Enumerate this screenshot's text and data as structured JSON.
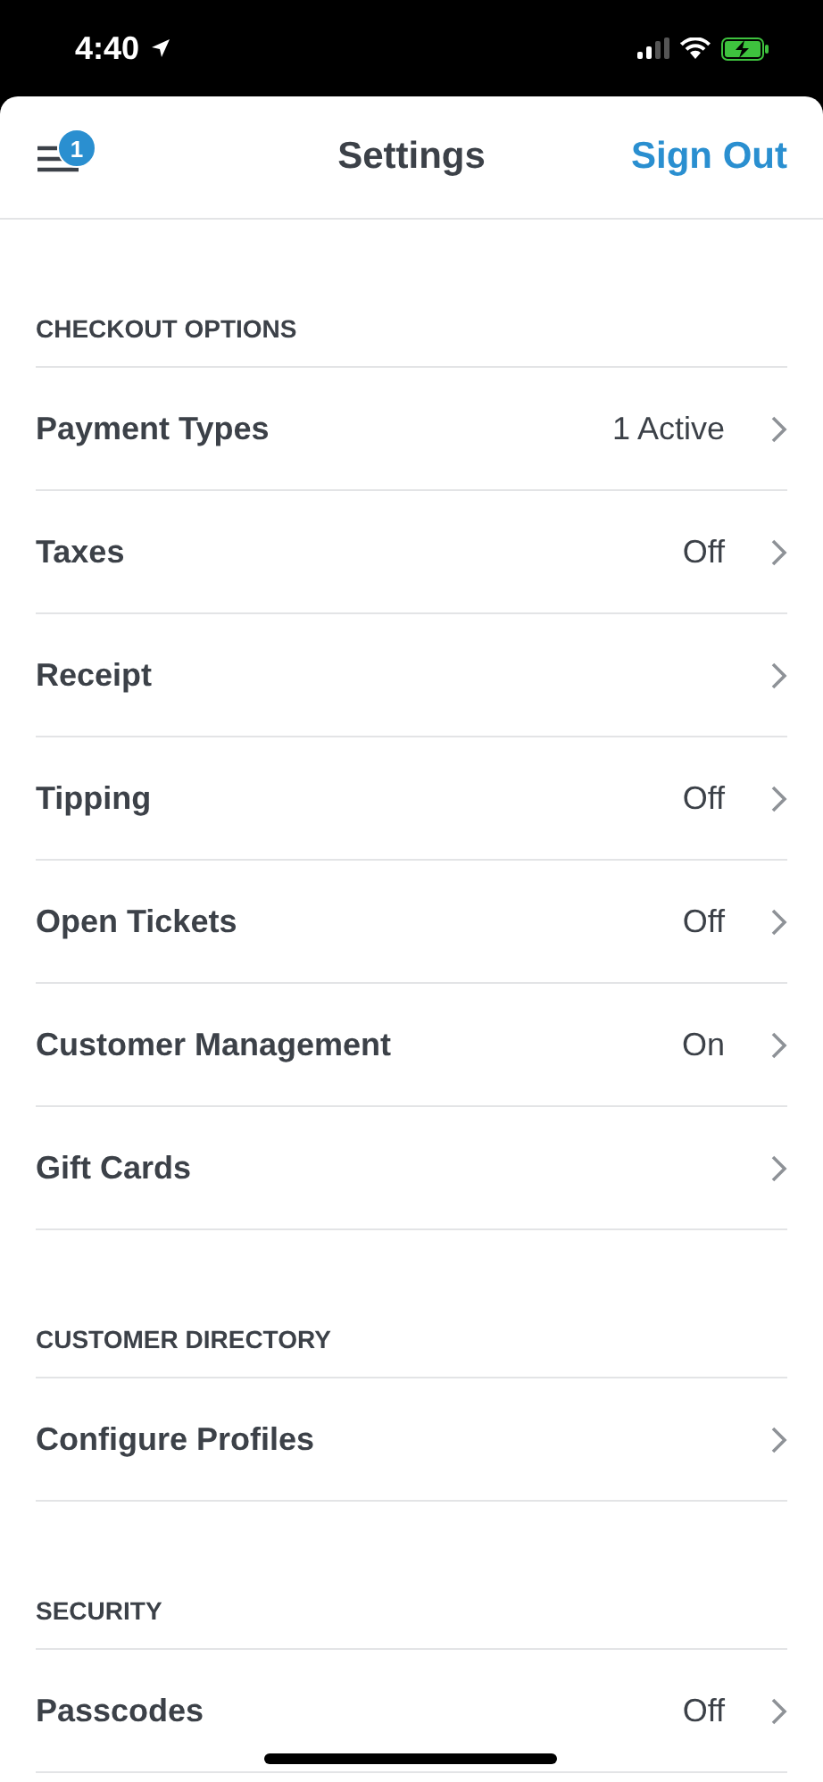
{
  "status_bar": {
    "time": "4:40"
  },
  "header": {
    "title": "Settings",
    "menu_badge": "1",
    "action": "Sign Out"
  },
  "sections": [
    {
      "title": "CHECKOUT OPTIONS",
      "rows": [
        {
          "label": "Payment Types",
          "value": "1 Active"
        },
        {
          "label": "Taxes",
          "value": "Off"
        },
        {
          "label": "Receipt"
        },
        {
          "label": "Tipping",
          "value": "Off"
        },
        {
          "label": "Open Tickets",
          "value": "Off"
        },
        {
          "label": "Customer Management",
          "value": "On"
        },
        {
          "label": "Gift Cards"
        }
      ]
    },
    {
      "title": "CUSTOMER DIRECTORY",
      "rows": [
        {
          "label": "Configure Profiles"
        }
      ]
    },
    {
      "title": "SECURITY",
      "rows": [
        {
          "label": "Passcodes",
          "value": "Off"
        }
      ]
    }
  ]
}
